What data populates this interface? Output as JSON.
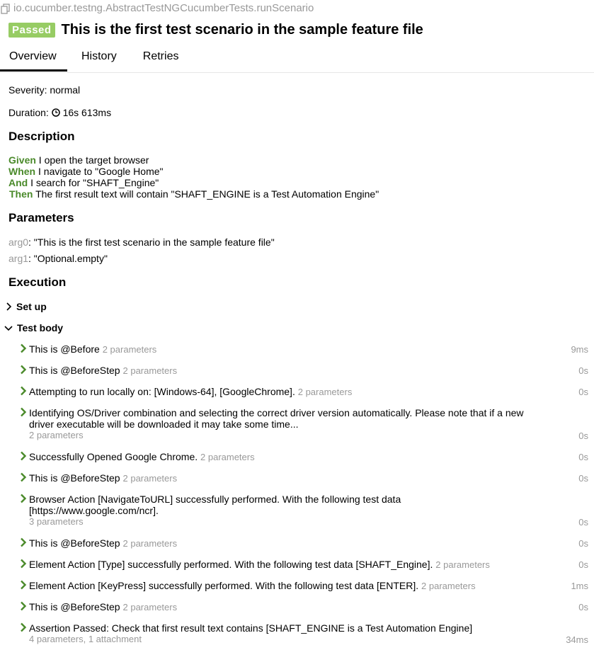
{
  "header": {
    "path": "io.cucumber.testng.AbstractTestNGCucumberTests.runScenario",
    "status": "Passed",
    "title": "This is the first test scenario in the sample feature file"
  },
  "tabs": [
    "Overview",
    "History",
    "Retries"
  ],
  "severity": "Severity: normal",
  "duration_label": "Duration:",
  "duration": "16s 613ms",
  "description": {
    "heading": "Description",
    "lines": [
      {
        "kw": "Given",
        "text": " I open the target browser"
      },
      {
        "kw": "When",
        "text": " I navigate to \"Google Home\""
      },
      {
        "kw": "And",
        "text": " I search for \"SHAFT_Engine\""
      },
      {
        "kw": "Then",
        "text": " The first result text will contain \"SHAFT_ENGINE is a Test Automation Engine\""
      }
    ]
  },
  "parameters": {
    "heading": "Parameters",
    "items": [
      {
        "name": "arg0",
        "value": ": \"This is the first test scenario in the sample feature file\""
      },
      {
        "name": "arg1",
        "value": ": \"Optional.empty\""
      }
    ]
  },
  "execution": {
    "heading": "Execution",
    "setup": "Set up",
    "body": "Test body",
    "steps": [
      {
        "text": "This is @Before",
        "params": "2 parameters",
        "dur": "9ms"
      },
      {
        "text": "This is @BeforeStep",
        "params": "2 parameters",
        "dur": "0s"
      },
      {
        "text": "Attempting to run locally on: [Windows-64], [GoogleChrome].",
        "params": "2 parameters",
        "dur": "0s"
      },
      {
        "text1": "Identifying OS/Driver combination and selecting the correct driver version automatically. Please note that if a new",
        "text2": "driver executable will be downloaded it may take some time...",
        "params": "2 parameters",
        "dur": "0s"
      },
      {
        "text": "Successfully Opened Google Chrome.",
        "params": "2 parameters",
        "dur": "0s"
      },
      {
        "text": "This is @BeforeStep",
        "params": "2 parameters",
        "dur": "0s"
      },
      {
        "text1": "Browser Action [NavigateToURL] successfully performed. With the following test data",
        "text2": "[https://www.google.com/ncr].",
        "params": "3 parameters",
        "dur": "0s"
      },
      {
        "text": "This is @BeforeStep",
        "params": "2 parameters",
        "dur": "0s"
      },
      {
        "text": "Element Action [Type] successfully performed. With the following test data [SHAFT_Engine].",
        "params": "2 parameters",
        "dur": "0s"
      },
      {
        "text": "Element Action [KeyPress] successfully performed. With the following test data [ENTER].",
        "params": "2 parameters",
        "dur": "1ms"
      },
      {
        "text": "This is @BeforeStep",
        "params": "2 parameters",
        "dur": "0s"
      },
      {
        "text1": "Assertion Passed: Check that first result text contains [SHAFT_ENGINE is a Test Automation Engine]",
        "params": "4 parameters, 1 attachment",
        "dur": "34ms"
      }
    ]
  }
}
